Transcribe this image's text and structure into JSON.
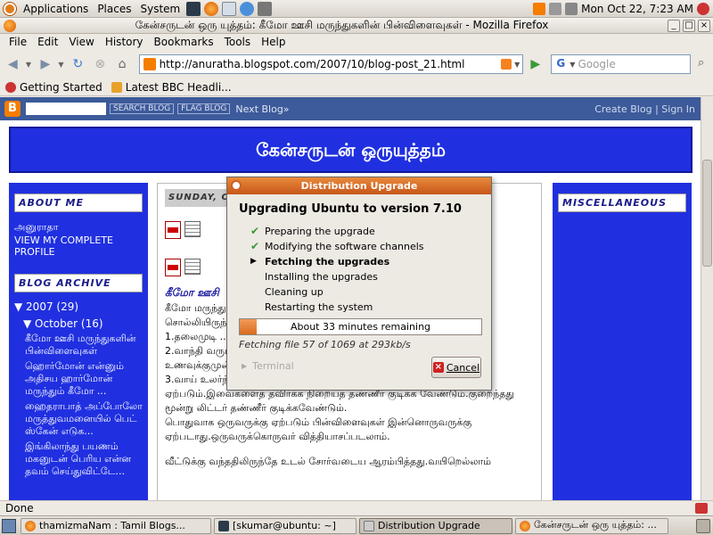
{
  "top_panel": {
    "menus": [
      "Applications",
      "Places",
      "System"
    ],
    "clock": "Mon Oct 22,  7:23 AM"
  },
  "window": {
    "title": "கேன்சருடன் ஒரு யுத்தம்: கீமோ ஊசி மருந்துகளின் பின்விளைவுகள் - Mozilla Firefox"
  },
  "menubar": [
    "File",
    "Edit",
    "View",
    "History",
    "Bookmarks",
    "Tools",
    "Help"
  ],
  "navbar": {
    "url": "http://anuratha.blogspot.com/2007/10/blog-post_21.html",
    "search_placeholder": "Google"
  },
  "bookmarks": [
    "Getting Started",
    "Latest BBC Headli..."
  ],
  "blogger_bar": {
    "search_button": "SEARCH BLOG",
    "flag_button": "FLAG BLOG",
    "next_blog": "Next Blog»",
    "create_blog": "Create Blog",
    "sign_in": "Sign In",
    "sep": "|"
  },
  "blog": {
    "header": "கேன்சருடன் ஒருயுத்தம்",
    "about_title": "ABOUT ME",
    "author": "அனுராதா",
    "view_profile": "VIEW MY COMPLETE PROFILE",
    "archive_title": "BLOG ARCHIVE",
    "archive_year": "▼ 2007 (29)",
    "archive_month": "▼ October (16)",
    "archive_posts": [
      "கீமோ ஊசி மருந்துகளின் பின்விளைவுகள்",
      "ஹொர்மோன் என்னும் அதிசய ஹார்மோன் மருந்தும் கீமோ ...",
      "ஹைதராபாத் அப்போலோ மருத்துவமனையில் பெட் ஸ்கேன் எடுக...",
      "இங்கிலாந்து பயணம் மகனுடன் பெரிய என்ன தவம் செய்துவிட்டே..."
    ],
    "date": "SUNDAY, O",
    "post_title": "கீமோ ஊசி",
    "post_lines": [
      "கீமோ மருந்து...                                              டாக்டர்",
      "சொல்லியிருந்த...",
      "1.தலைமுடி ...                                                     விடும்.",
      "2.வாந்தி வரும்...",
      "உணவுக்குமுன் இந்த மாத்திரையை உட்கொள்ள வேண்டும்.",
      "3.வாய் உலர்ந்து வரும்.மலச்சிக்கல் ஏற்படும்.அல்லது டயோரியா",
      "ஏற்படும்.இவைகளைத் தவிர்க்க நிறையத் தண்ணீர் குடிக்க வேண்டும்.குறைந்தது",
      "மூன்று லிட்டர் தண்ணீர் குடிக்கவேண்டும்.",
      "பொதுவாக ஒருவருக்கு ஏற்படும் பின்விளைவுகள் இன்னொருவருக்கு",
      "ஏற்படாது.ஒருவருக்கொருவர் வித்தியாசப்படலாம்.",
      "",
      "வீட்டுக்கு வந்ததிலிருந்தே உடல் சோர்வடைய ஆரம்பித்தது.வயிறெல்லாம்"
    ],
    "misc_title": "MISCELLANEOUS"
  },
  "dialog": {
    "title": "Distribution Upgrade",
    "heading": "Upgrading Ubuntu to version 7.10",
    "steps": [
      {
        "label": "Preparing the upgrade",
        "state": "done"
      },
      {
        "label": "Modifying the software channels",
        "state": "done"
      },
      {
        "label": "Fetching the upgrades",
        "state": "current"
      },
      {
        "label": "Installing the upgrades",
        "state": "pending"
      },
      {
        "label": "Cleaning up",
        "state": "pending"
      },
      {
        "label": "Restarting the system",
        "state": "pending"
      }
    ],
    "progress_fraction": 0.07,
    "progress_text": "About 33 minutes remaining",
    "fetch_status": "Fetching file 57 of 1069 at 293kb/s",
    "terminal_label": "Terminal",
    "cancel_label": "Cancel"
  },
  "status_bar": "Done",
  "taskbar": [
    {
      "label": "thamizmaNam : Tamil Blogs...",
      "active": false
    },
    {
      "label": "[skumar@ubuntu: ~]",
      "active": false
    },
    {
      "label": "Distribution Upgrade",
      "active": true
    },
    {
      "label": "கேன்சருடன் ஒரு யுத்தம்: ...",
      "active": false
    }
  ],
  "colors": {
    "blog_blue": "#2030e0",
    "dialog_accent": "#d96a1f",
    "blogger_bar": "#3d5a9a"
  }
}
